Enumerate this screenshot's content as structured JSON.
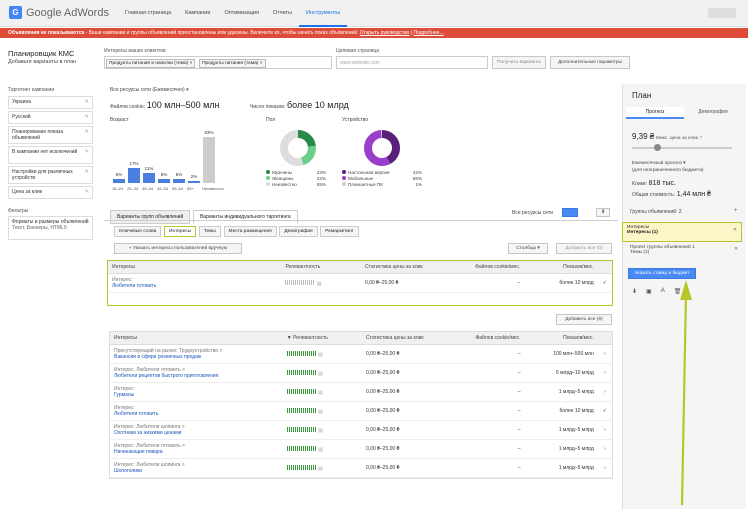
{
  "topbar": {
    "logo_text": "Google AdWords",
    "nav": [
      "Главная страница",
      "Кампании",
      "Оптимизация",
      "Отчеты",
      "Инструменты"
    ]
  },
  "alert": {
    "bold": "Объявления не показываются",
    "text": " - Ваши кампании и группы объявлений приостановлены или удалены. Включите их, чтобы начать показ объявлений.",
    "link1": "Открыть руководство",
    "sep": "|",
    "link2": "Подробнее..."
  },
  "header": {
    "title": "Планировщик КМС",
    "subtitle": "Добавьте варианты в план",
    "interests_label": "Интересы ваших клиентов",
    "chips": [
      "Продукты питания и напитки (тема)",
      "Продукты питания (тема)"
    ],
    "target_label": "Целевая страница",
    "target_placeholder": "www.website.com",
    "btn_get": "Получить варианты",
    "btn_more": "Дополнительные параметры"
  },
  "sidebar": {
    "targeting_label": "Таргетинг кампании",
    "items": [
      "Украина",
      "Русский",
      "Планирование показа объявлений",
      "В кампании нет исключений",
      "Настройки для различных устройств",
      "Цена за клик"
    ],
    "filters_label": "Фильтры",
    "filter_item_title": "Форматы и размеры объявлений",
    "filter_item_sub": "Текст, Баннеры, HTML5"
  },
  "overview": {
    "source": "Все ресурсы сети (Ежемесячно)",
    "cookies_label": "Файлов cookie:",
    "cookies_value": "100 млн–500 млн",
    "impr_label": "Число показов:",
    "impr_value": "более 10 млрд",
    "age_title": "Возраст",
    "gender_title": "Пол",
    "device_title": "Устройство",
    "genders": [
      {
        "name": "Мужчины",
        "pct": "23%",
        "color": "#2a8a4a"
      },
      {
        "name": "Женщины",
        "pct": "22%",
        "color": "#6bd08a"
      },
      {
        "name": "Неизвестно",
        "pct": "55%",
        "color": "#dddddd"
      }
    ],
    "devices": [
      {
        "name": "Настольная версия",
        "pct": "42%",
        "color": "#5a1f7a"
      },
      {
        "name": "Мобильные",
        "pct": "56%",
        "color": "#9a3fca"
      },
      {
        "name": "Планшетные ПК",
        "pct": "1%",
        "color": "#cccccc"
      }
    ]
  },
  "age_chart": {
    "type": "bar",
    "categories": [
      "18–24",
      "25–34",
      "35–44",
      "45–54",
      "55–64",
      "65+",
      "Неизвестно"
    ],
    "values": [
      5,
      17,
      11,
      5,
      5,
      2,
      53
    ],
    "labels": [
      "5%",
      "17%",
      "11%",
      "5%",
      "5%",
      "2%",
      "53%"
    ],
    "colors": [
      "#4a7fe0",
      "#4a7fe0",
      "#4a7fe0",
      "#4a7fe0",
      "#4a7fe0",
      "#4a7fe0",
      "#cccccc"
    ]
  },
  "tabs": {
    "main": [
      "Варианты групп объявлений",
      "Варианты индивидуального таргетинга"
    ],
    "source_select": "Все ресурсы сети",
    "sub": [
      "Ключевые слова",
      "Интересы",
      "Темы",
      "Места размещения",
      "Демография",
      "Ремаркетинг"
    ],
    "add_manual": "+ Указать интересы пользователей вручную",
    "columns_btn": "Столбцы",
    "add_all": "Добавить все (0)",
    "add_all2": "Добавить все (6)"
  },
  "table1": {
    "headers": [
      "Интересы",
      "Релевантность",
      "Статистика цены за клик",
      "Файлов cookie/мес.",
      "Показов/мес."
    ],
    "rows": [
      {
        "prefix": "Интерес:",
        "path": "",
        "link": "Любители готовить",
        "cpc": "0,00 ₴–25,00 ₴",
        "cookies": "–",
        "impr": "более 10 млрд",
        "action": "✓"
      }
    ]
  },
  "table2": {
    "headers": [
      "Интересы",
      "Релевантность",
      "Статистика цены за клик",
      "Файлов cookie/мес.",
      "Показов/мес."
    ],
    "rows": [
      {
        "prefix": "Присутствующий на рынке:",
        "path": "Трудоустройство >",
        "link": "Вакансии в сфере розничных продаж",
        "cpc": "0,00 ₴–25,00 ₴",
        "cookies": "–",
        "impr": "100 млн–500 млн",
        "action": "»"
      },
      {
        "prefix": "Интерес:",
        "path": "Любители готовить >",
        "link": "Любители рецептов быстрого приготовления",
        "cpc": "0,00 ₴–25,00 ₴",
        "cookies": "–",
        "impr": "5 млрд–10 млрд",
        "action": "»"
      },
      {
        "prefix": "Интерес:",
        "path": "",
        "link": "Гурманы",
        "cpc": "0,00 ₴–25,00 ₴",
        "cookies": "–",
        "impr": "1 млрд–5 млрд",
        "action": "»"
      },
      {
        "prefix": "Интерес:",
        "path": "",
        "link": "Любители готовить",
        "cpc": "0,00 ₴–25,00 ₴",
        "cookies": "–",
        "impr": "более 10 млрд",
        "action": "✓"
      },
      {
        "prefix": "Интерес:",
        "path": "Любители шопинга >",
        "link": "Охотники за низкими ценами",
        "cpc": "0,00 ₴–25,00 ₴",
        "cookies": "–",
        "impr": "1 млрд–5 млрд",
        "action": "»"
      },
      {
        "prefix": "Интерес:",
        "path": "Любители готовить >",
        "link": "Начинающие повара",
        "cpc": "0,00 ₴–25,00 ₴",
        "cookies": "–",
        "impr": "1 млрд–5 млрд",
        "action": "»"
      },
      {
        "prefix": "Интерес:",
        "path": "Любители шопинга >",
        "link": "Шопоголики",
        "cpc": "0,00 ₴–25,00 ₴",
        "cookies": "–",
        "impr": "1 млрд–5 млрд",
        "action": "»"
      }
    ]
  },
  "plan": {
    "title": "План",
    "tab_forecast": "Прогноз",
    "tab_demo": "Демография",
    "cpc_value": "9,39 ₴",
    "cpc_label": "Макс. цена за клик",
    "monthly": "Ежемесячный прогноз",
    "monthly_sub": "(для неограниченного бюджета)",
    "clicks_label": "Клики:",
    "clicks_value": "818 тыс.",
    "cost_label": "Общая стоимость:",
    "cost_value": "1,44 млн ₴",
    "groups_label": "Группы объявлений: 2",
    "group1_title": "Интересы",
    "group1_sub": "Интересы (1)",
    "group2_title": "Проект группы объявлений 1",
    "group2_sub": "Темы (2)",
    "bid_btn": "Указать ставку и бюджет"
  }
}
